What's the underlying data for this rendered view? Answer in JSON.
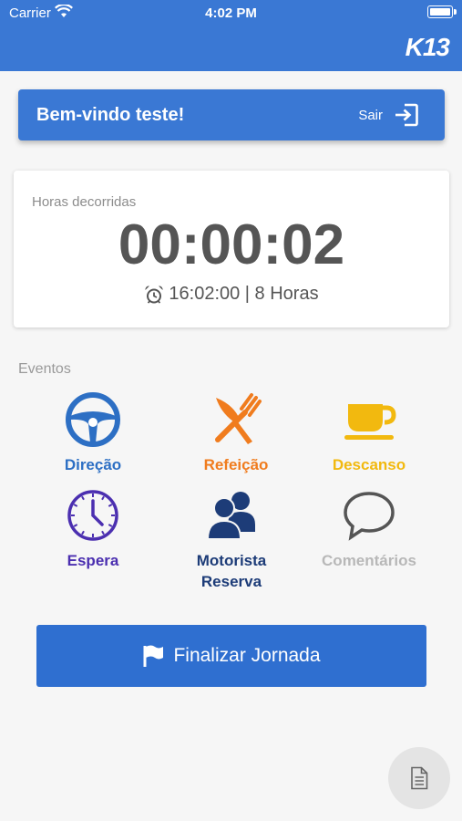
{
  "status_bar": {
    "carrier": "Carrier",
    "time": "4:02 PM"
  },
  "header": {
    "logo": "K13",
    "color": "#3a78d4"
  },
  "welcome": {
    "text": "Bem-vindo teste!",
    "logout_label": "Sair"
  },
  "timer": {
    "label": "Horas decorridas",
    "value": "00:00:02",
    "start_time": "16:02:00 | 8 Horas"
  },
  "events": {
    "title": "Eventos",
    "items": [
      {
        "label": "Direção",
        "icon": "steering-wheel-icon",
        "color": "#2d6fc4"
      },
      {
        "label": "Refeição",
        "icon": "fork-knife-icon",
        "color": "#f07c1e"
      },
      {
        "label": "Descanso",
        "icon": "coffee-cup-icon",
        "color": "#f2b90f"
      },
      {
        "label": "Espera",
        "icon": "clock-icon",
        "color": "#4b2fb0"
      },
      {
        "label": "Motorista\nReserva",
        "icon": "users-icon",
        "color": "#1d3c78"
      },
      {
        "label": "Comentários",
        "icon": "comment-icon",
        "color": "#b8b8b8"
      }
    ]
  },
  "finish_button": {
    "label": "Finalizar Jornada",
    "color": "#2f6fd0"
  },
  "fab": {
    "icon": "document-icon"
  }
}
